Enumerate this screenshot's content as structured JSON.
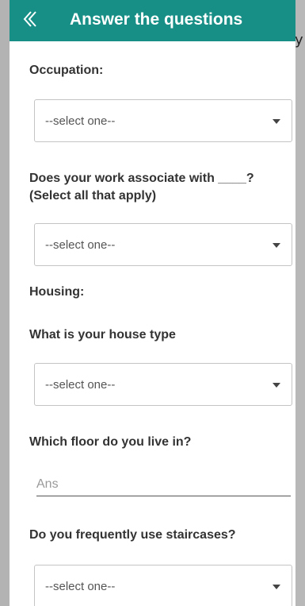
{
  "header": {
    "title": "Answer the questions"
  },
  "edge": {
    "left_char": "",
    "right_char": "y"
  },
  "form": {
    "occupation": {
      "label": "Occupation:",
      "selected": "--select one--"
    },
    "work_associate": {
      "label": "Does your work associate with ____?\n(Select all that apply)",
      "selected": "--select one--"
    },
    "housing": {
      "label": "Housing:"
    },
    "house_type": {
      "label": "What is your house type",
      "selected": "--select one--"
    },
    "floor": {
      "label": "Which floor do you live in?",
      "placeholder": "Ans"
    },
    "staircases": {
      "label": "Do you frequently use staircases?",
      "selected": "--select one--"
    }
  },
  "colors": {
    "app_bar": "#178f86",
    "background": "#b8b8b8"
  }
}
